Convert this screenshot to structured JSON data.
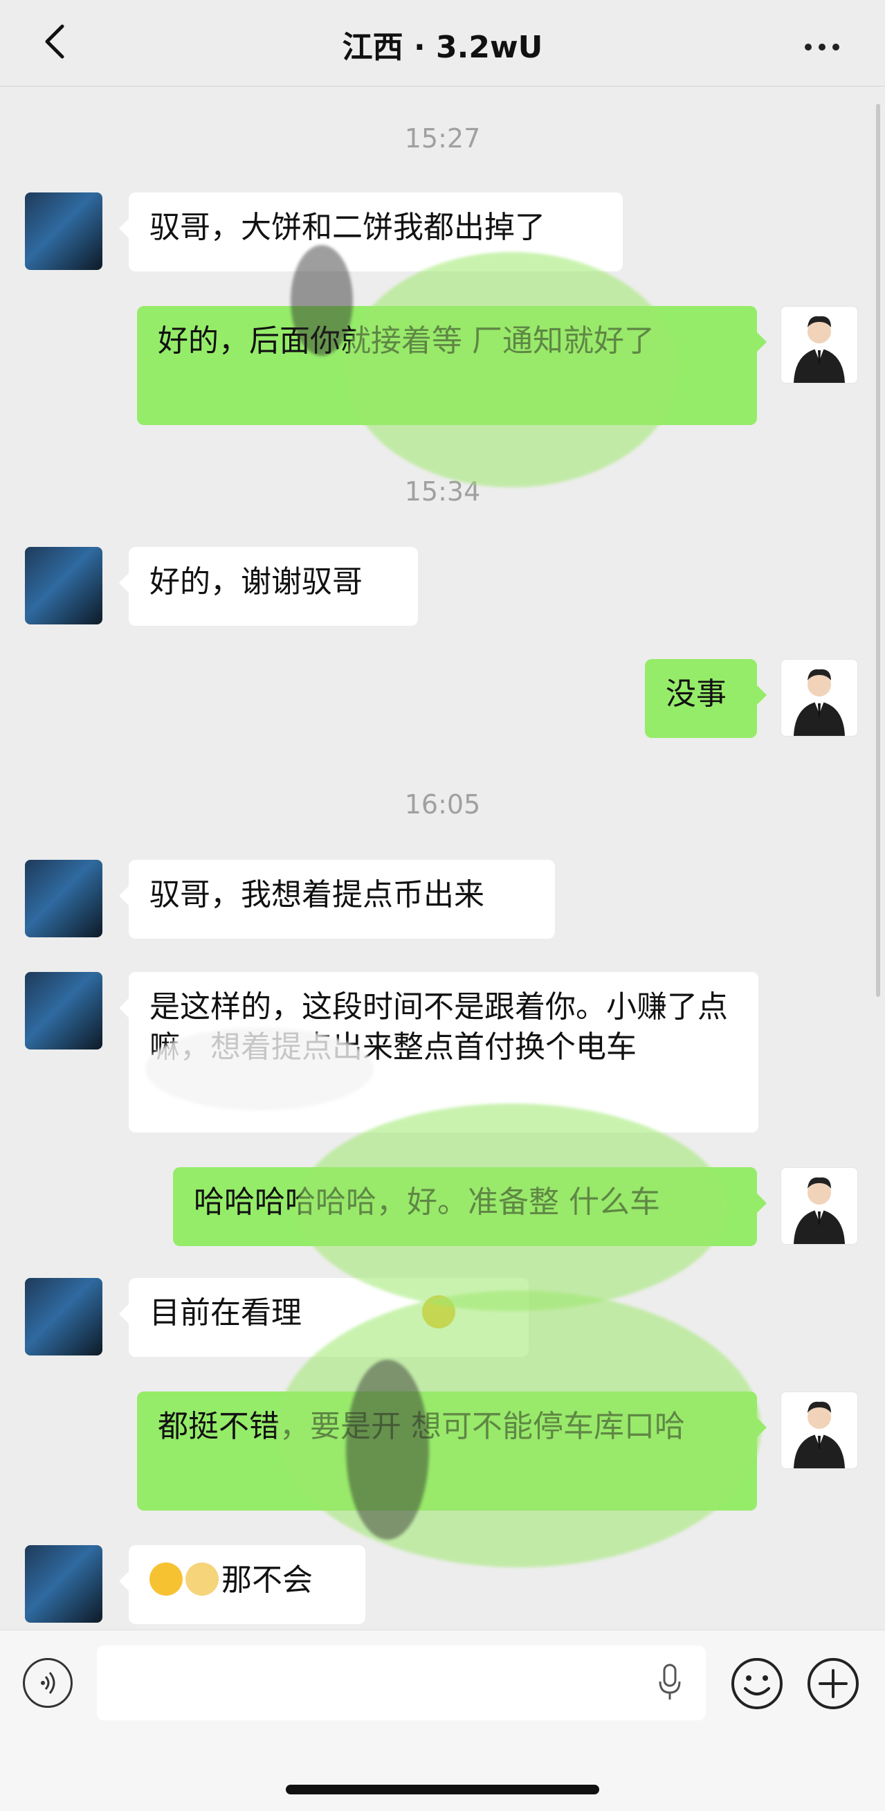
{
  "header": {
    "title": "江西 · 3.2wU"
  },
  "messages": [
    {
      "type": "time",
      "text": "15:27"
    },
    {
      "type": "in",
      "text": "驭哥，大饼和二饼我都出掉了"
    },
    {
      "type": "out",
      "text": "好的，后面你就接着等 厂通知就好了"
    },
    {
      "type": "time",
      "text": "15:34"
    },
    {
      "type": "in",
      "text": "好的，谢谢驭哥"
    },
    {
      "type": "out",
      "text": "没事"
    },
    {
      "type": "time",
      "text": "16:05"
    },
    {
      "type": "in",
      "text": "驭哥，我想着提点币出来"
    },
    {
      "type": "in",
      "text": "是这样的，这段时间不是跟着你。小赚了点嘛，想着提点出来整点首付换个电车"
    },
    {
      "type": "out",
      "text": "哈哈哈哈哈哈，好。准备整 什么车"
    },
    {
      "type": "in",
      "text": "目前在看理"
    },
    {
      "type": "out",
      "text": "都挺不错，要是开 想可不能停车库口哈"
    },
    {
      "type": "in",
      "text": "那不会"
    }
  ],
  "colors": {
    "out_bubble": "#95ec69",
    "in_bubble": "#ffffff",
    "background": "#ededed"
  },
  "icons": [
    "back-arrow-icon",
    "more-dots-icon",
    "voice-icon",
    "microphone-icon",
    "emoji-icon",
    "plus-icon"
  ]
}
